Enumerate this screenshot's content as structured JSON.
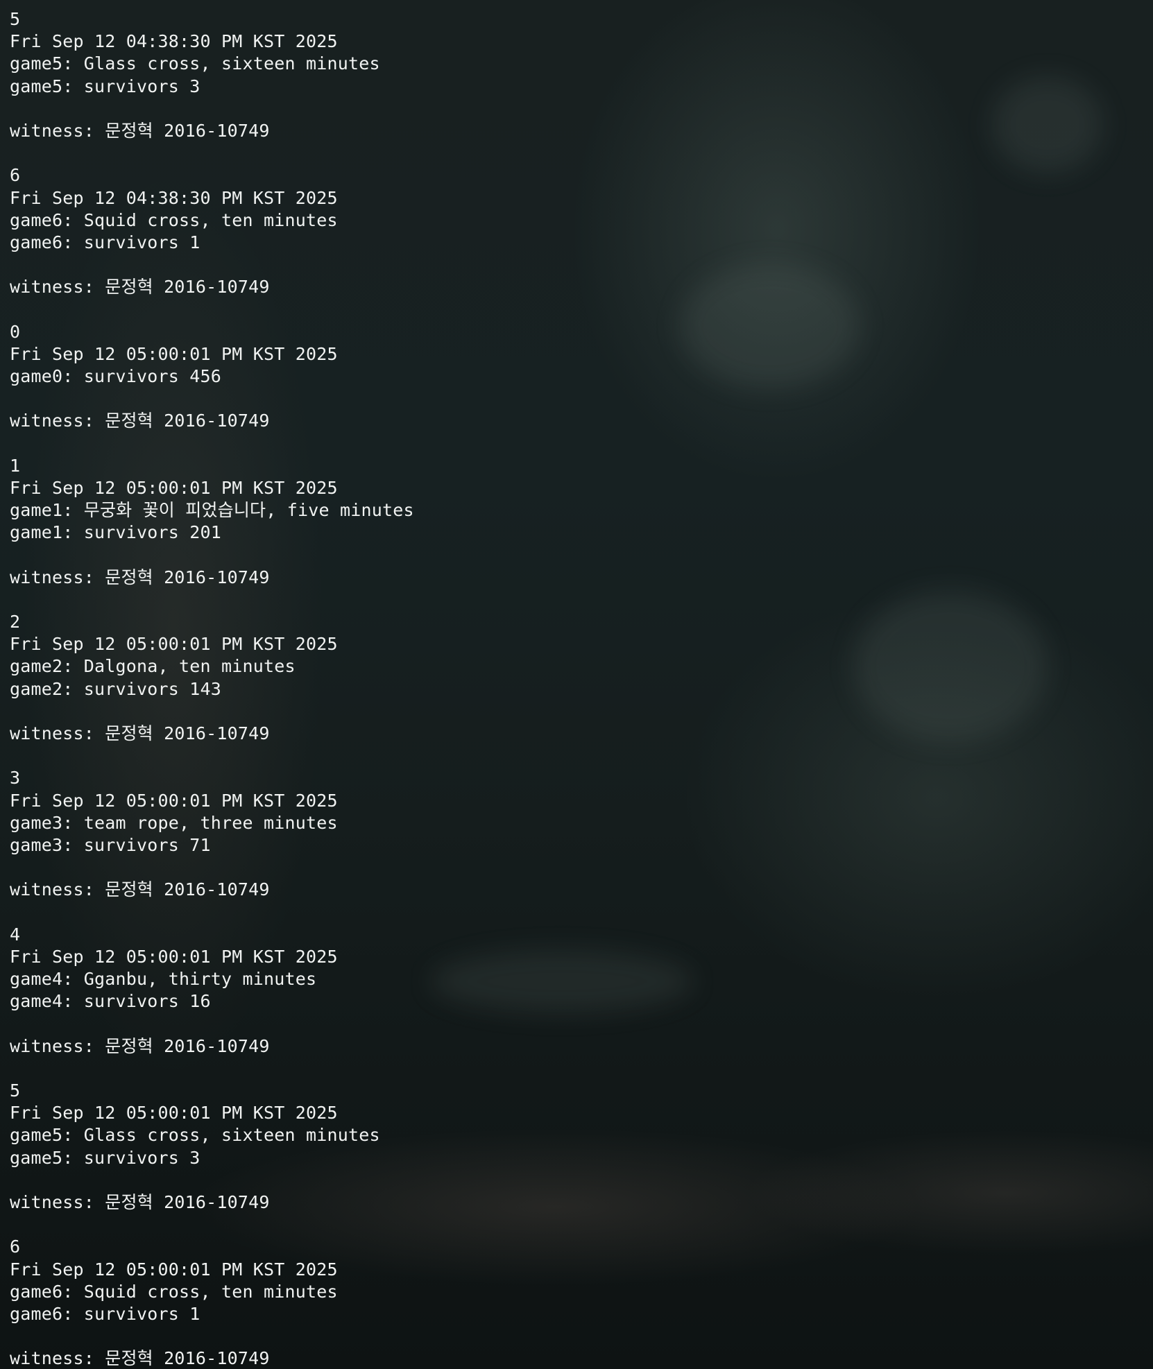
{
  "terminal": {
    "lines": [
      "5",
      "Fri Sep 12 04:38:30 PM KST 2025",
      "game5: Glass cross, sixteen minutes",
      "game5: survivors 3",
      "",
      "witness: 문정혁 2016-10749",
      "",
      "6",
      "Fri Sep 12 04:38:30 PM KST 2025",
      "game6: Squid cross, ten minutes",
      "game6: survivors 1",
      "",
      "witness: 문정혁 2016-10749",
      "",
      "0",
      "Fri Sep 12 05:00:01 PM KST 2025",
      "game0: survivors 456",
      "",
      "witness: 문정혁 2016-10749",
      "",
      "1",
      "Fri Sep 12 05:00:01 PM KST 2025",
      "game1: 무궁화 꽃이 피었습니다, five minutes",
      "game1: survivors 201",
      "",
      "witness: 문정혁 2016-10749",
      "",
      "2",
      "Fri Sep 12 05:00:01 PM KST 2025",
      "game2: Dalgona, ten minutes",
      "game2: survivors 143",
      "",
      "witness: 문정혁 2016-10749",
      "",
      "3",
      "Fri Sep 12 05:00:01 PM KST 2025",
      "game3: team rope, three minutes",
      "game3: survivors 71",
      "",
      "witness: 문정혁 2016-10749",
      "",
      "4",
      "Fri Sep 12 05:00:01 PM KST 2025",
      "game4: Gganbu, thirty minutes",
      "game4: survivors 16",
      "",
      "witness: 문정혁 2016-10749",
      "",
      "5",
      "Fri Sep 12 05:00:01 PM KST 2025",
      "game5: Glass cross, sixteen minutes",
      "game5: survivors 3",
      "",
      "witness: 문정혁 2016-10749",
      "",
      "6",
      "Fri Sep 12 05:00:01 PM KST 2025",
      "game6: Squid cross, ten minutes",
      "game6: survivors 1",
      "",
      "witness: 문정혁 2016-10749"
    ]
  },
  "colors": {
    "text": "#f1f3f2",
    "background": "#151d1d"
  }
}
